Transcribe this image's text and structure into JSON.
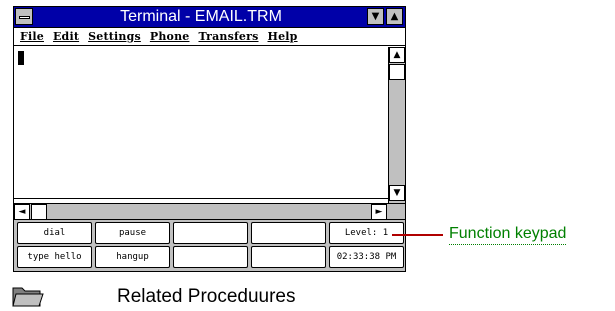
{
  "window": {
    "title": "Terminal - EMAIL.TRM",
    "system_menu_icon": "system-menu-icon",
    "minimize_glyph": "▼",
    "maximize_glyph": "▲"
  },
  "menu": [
    "File",
    "Edit",
    "Settings",
    "Phone",
    "Transfers",
    "Help"
  ],
  "scrollbar": {
    "up": "▲",
    "down": "▼",
    "left": "◄",
    "right": "►"
  },
  "keypad": {
    "row1": [
      "dial",
      "pause",
      "",
      "",
      "Level: 1"
    ],
    "row2": [
      "type hello",
      "hangup",
      "",
      "",
      "02:33:38 PM"
    ]
  },
  "callout": "Function keypad",
  "related": {
    "icon": "folder-icon",
    "label": "Related Proceduures"
  },
  "colors": {
    "titlebar": "#0000a8",
    "callout_text": "#008000",
    "callout_line": "#b00000"
  }
}
